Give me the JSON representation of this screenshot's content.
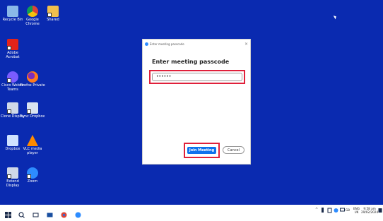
{
  "desktop_icons": [
    {
      "label": "Recycle Bin",
      "icon": "recycle-bin-icon",
      "color": "#8ab8e8"
    },
    {
      "label": "Google Chrome",
      "icon": "chrome-icon",
      "color": "#f4c20d"
    },
    {
      "label": "Shared",
      "icon": "folder-icon",
      "color": "#f2c04d"
    },
    {
      "label": "Adobe Acrobat",
      "icon": "acrobat-icon",
      "color": "#e2231a"
    },
    {
      "label": "Cisco Webex Teams",
      "icon": "teams-icon",
      "color": "#7a5cff"
    },
    {
      "label": "Firefox Private",
      "icon": "firefox-icon",
      "color": "#ff7a1a"
    },
    {
      "label": "Clone Display",
      "icon": "clone-display-icon",
      "color": "#cfd8e8"
    },
    {
      "label": "Sync Dropbox",
      "icon": "sync-dropbox-icon",
      "color": "#d9e3f0"
    },
    {
      "label": "Dropbox",
      "icon": "dropbox-icon",
      "color": "#cfe2ff"
    },
    {
      "label": "VLC media player",
      "icon": "vlc-icon",
      "color": "#ff8a00"
    },
    {
      "label": "Extend Display",
      "icon": "extend-display-icon",
      "color": "#cfd8e8"
    },
    {
      "label": "Zoom",
      "icon": "zoom-icon",
      "color": "#2d8cff"
    }
  ],
  "dialog": {
    "title": "Enter meeting passcode",
    "close_label": "×",
    "heading": "Enter meeting passcode",
    "passcode_value": "••••••",
    "join_label": "Join Meeting",
    "cancel_label": "Cancel"
  },
  "taskbar": {
    "search_icon": "search-icon",
    "time": "9:58 am",
    "date": "29/02/2024",
    "lang": "ENG",
    "lang_sub": "UK",
    "tray_extra": "G8"
  }
}
